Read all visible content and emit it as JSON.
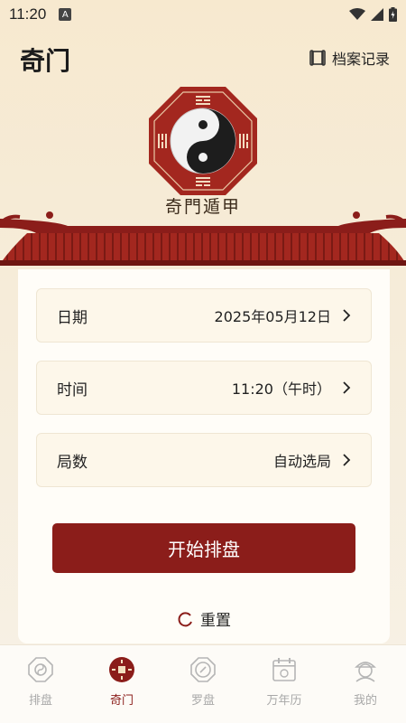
{
  "status_bar": {
    "time": "11:20",
    "notification_badge": "A"
  },
  "header": {
    "title": "奇门",
    "archive_label": "档案记录"
  },
  "logo": {
    "caption": "奇門遁甲"
  },
  "form": {
    "date": {
      "label": "日期",
      "value": "2025年05月12日"
    },
    "time": {
      "label": "时间",
      "value": "11:20（午时）"
    },
    "ju": {
      "label": "局数",
      "value": "自动选局"
    }
  },
  "actions": {
    "start_label": "开始排盘",
    "reset_label": "重置"
  },
  "bottom_nav": [
    {
      "label": "排盘",
      "icon": "bagua-icon",
      "active": false
    },
    {
      "label": "奇门",
      "icon": "qimen-icon",
      "active": true
    },
    {
      "label": "罗盘",
      "icon": "compass-icon",
      "active": false
    },
    {
      "label": "万年历",
      "icon": "calendar-icon",
      "active": false
    },
    {
      "label": "我的",
      "icon": "profile-icon",
      "active": false
    }
  ],
  "colors": {
    "accent": "#8b1d1a",
    "inactive": "#a8a8a8",
    "background": "#f6eddc"
  }
}
